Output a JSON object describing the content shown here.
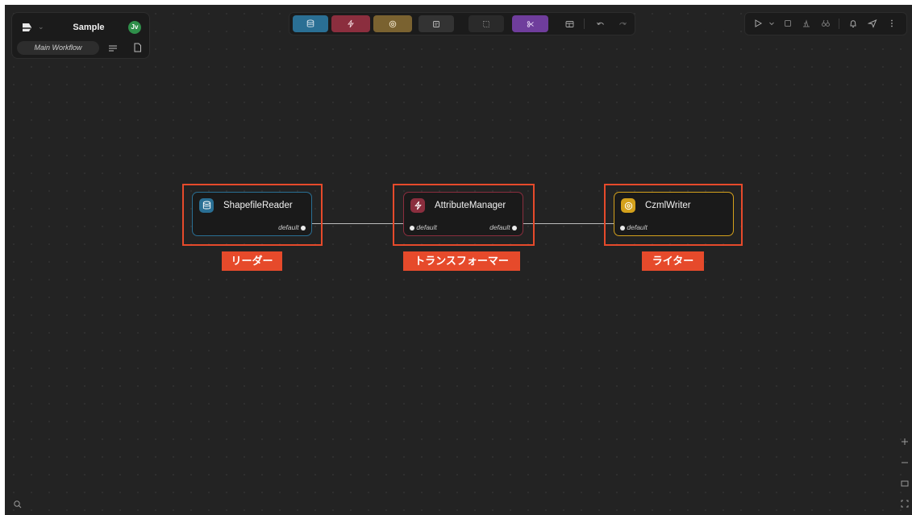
{
  "project": {
    "name": "Sample",
    "avatar_initials": "Jv",
    "workflow_tab": "Main Workflow",
    "icons": [
      "logo-icon",
      "chevron-down-icon",
      "list-icon",
      "page-icon"
    ]
  },
  "toolbar": {
    "buttons": [
      {
        "name": "reader-button",
        "icon": "database-icon",
        "color": "#2a6f94"
      },
      {
        "name": "transformer-button",
        "icon": "lightning-icon",
        "color": "#8b2e3e"
      },
      {
        "name": "writer-button",
        "icon": "target-icon",
        "color": "#7a6230"
      },
      {
        "name": "note-button",
        "icon": "note-icon",
        "color": "#3a3a3a"
      },
      {
        "name": "batch-button",
        "icon": "dashed-square-icon",
        "color": "#2d2d2d"
      },
      {
        "name": "subworkflow-button",
        "icon": "scissors-icon",
        "color": "#6f3d9c"
      }
    ],
    "extra_icons": [
      "layout-icon",
      "undo-icon",
      "redo-icon"
    ]
  },
  "run_panel": {
    "icons": [
      "play-icon",
      "chevron-down-icon",
      "stop-icon",
      "debug-icon",
      "binoculars-icon",
      "bell-icon",
      "send-icon",
      "more-icon"
    ]
  },
  "nodes": [
    {
      "name": "ShapefileReader",
      "output_port": "default",
      "color": "#2a6f94",
      "tag": "リーダー"
    },
    {
      "name": "AttributeManager",
      "input_port": "default",
      "output_port": "default",
      "color": "#8b2e3e",
      "tag": "トランスフォーマー"
    },
    {
      "name": "CzmlWriter",
      "input_port": "default",
      "color": "#d4a11c",
      "tag": "ライター"
    }
  ],
  "canvas_controls": [
    "zoom-in-icon",
    "zoom-out-icon",
    "fit-view-icon",
    "fullscreen-icon",
    "search-icon"
  ]
}
